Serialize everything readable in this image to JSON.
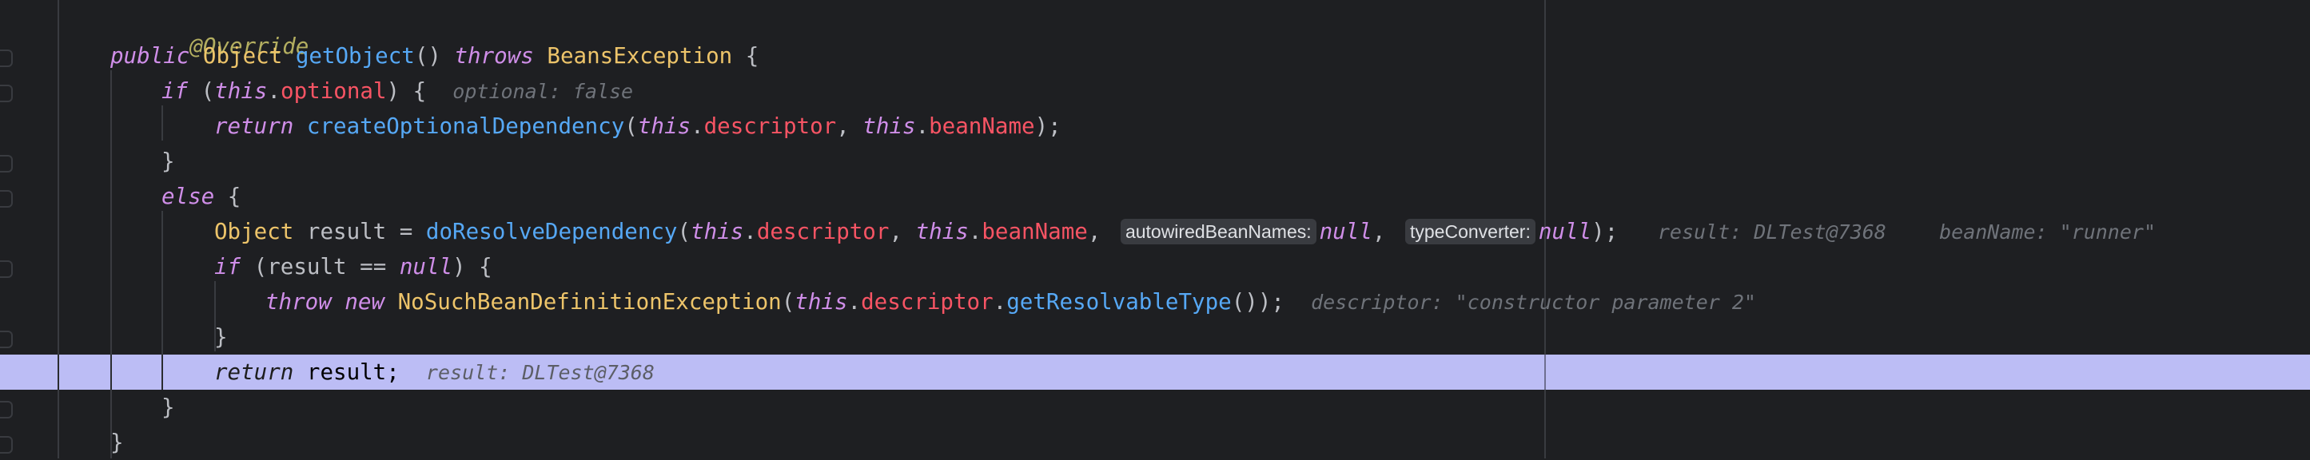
{
  "editor": {
    "lines": [
      {
        "annotation": "@Override"
      },
      {
        "mod": "public",
        "type": "Object",
        "method": "getObject",
        "paren": "() ",
        "throws": "throws",
        "exc": "BeansException",
        "brace": " {"
      },
      {
        "kw": "if",
        "p1": " (",
        "this": "this",
        "dot": ".",
        "field": "optional",
        "p2": ") {",
        "hint": "optional: false"
      },
      {
        "kw": "return",
        "method": "createOptionalDependency",
        "p1": "(",
        "this1": "this",
        "dot1": ".",
        "f1": "descriptor",
        "comma": ", ",
        "this2": "this",
        "dot2": ".",
        "f2": "beanName",
        "p2": ");"
      },
      {
        "brace": "}"
      },
      {
        "kw": "else",
        "brace": " {"
      },
      {
        "type": "Object",
        "var": " result = ",
        "method": "doResolveDependency",
        "p1": "(",
        "this1": "this",
        "dot1": ".",
        "f1": "descriptor",
        "comma": ", ",
        "this2": "this",
        "dot2": ".",
        "f2": "beanName",
        "comma2": ", ",
        "chip1": "autowiredBeanNames:",
        "null1": "null",
        "comma3": ", ",
        "chip2": "typeConverter:",
        "null2": "null",
        "p2": ");",
        "hint1": "result: DLTest@7368",
        "hint2": "beanName: \"runner\""
      },
      {
        "kw": "if",
        "p1": " (result == ",
        "null": "null",
        "p2": ") {"
      },
      {
        "kw1": "throw",
        "kw2": "new",
        "type": "NoSuchBeanDefinitionException",
        "p1": "(",
        "this": "this",
        "dot": ".",
        "field": "descriptor",
        "dot2": ".",
        "method": "getResolvableType",
        "p2": "());",
        "hint": "descriptor: \"constructor parameter 2\""
      },
      {
        "brace": "}"
      },
      {
        "kw": "return",
        "rest": " result;",
        "hint": "result: DLTest@7368"
      },
      {
        "brace": "}"
      },
      {
        "brace": "}"
      }
    ]
  }
}
